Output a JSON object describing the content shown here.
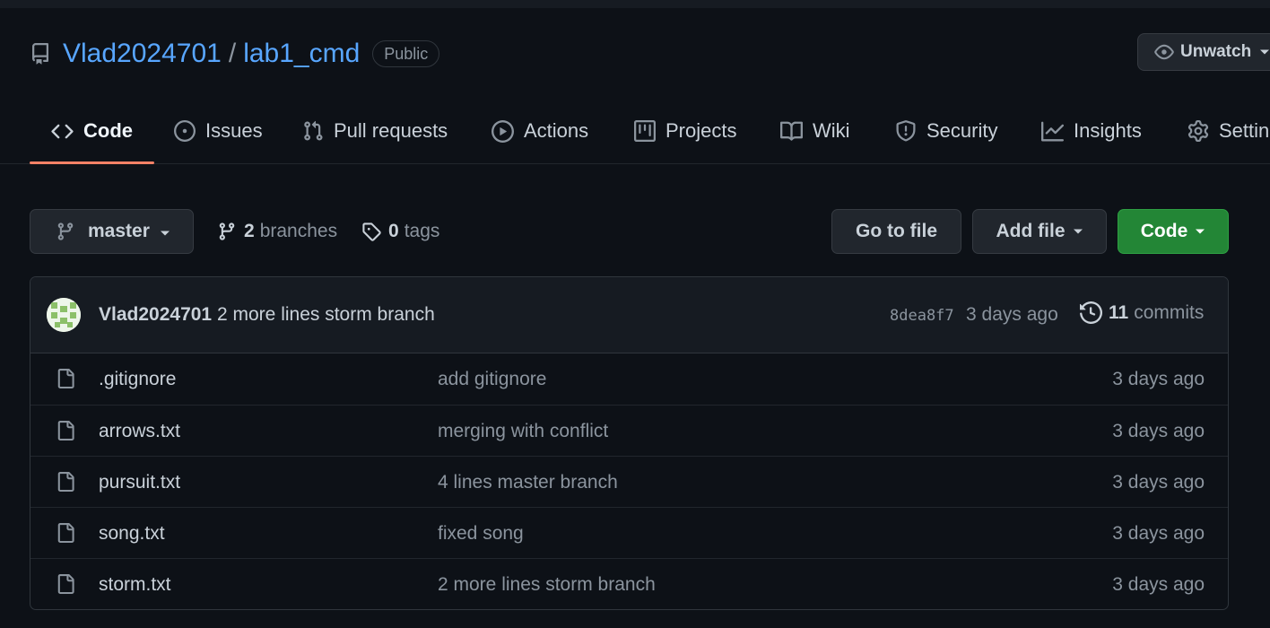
{
  "repo": {
    "owner": "Vlad2024701",
    "separator": "/",
    "name": "lab1_cmd",
    "visibility": "Public",
    "watch_label": "Unwatch"
  },
  "tabs": [
    {
      "label": "Code",
      "icon": "code-icon",
      "active": true
    },
    {
      "label": "Issues",
      "icon": "issue-icon"
    },
    {
      "label": "Pull requests",
      "icon": "pull-request-icon"
    },
    {
      "label": "Actions",
      "icon": "play-icon"
    },
    {
      "label": "Projects",
      "icon": "project-icon"
    },
    {
      "label": "Wiki",
      "icon": "book-icon"
    },
    {
      "label": "Security",
      "icon": "shield-icon"
    },
    {
      "label": "Insights",
      "icon": "graph-icon"
    },
    {
      "label": "Settin",
      "icon": "gear-icon"
    }
  ],
  "toolbar": {
    "branch": "master",
    "branches_count": "2",
    "branches_label": "branches",
    "tags_count": "0",
    "tags_label": "tags",
    "go_to_file": "Go to file",
    "add_file": "Add file",
    "code": "Code"
  },
  "latest_commit": {
    "author": "Vlad2024701",
    "message": "2 more lines storm branch",
    "sha": "8dea8f7",
    "age": "3 days ago",
    "commits_count": "11",
    "commits_label": "commits"
  },
  "files": [
    {
      "name": ".gitignore",
      "message": "add gitignore",
      "age": "3 days ago"
    },
    {
      "name": "arrows.txt",
      "message": "merging with conflict",
      "age": "3 days ago"
    },
    {
      "name": "pursuit.txt",
      "message": "4 lines master branch",
      "age": "3 days ago"
    },
    {
      "name": "song.txt",
      "message": "fixed song",
      "age": "3 days ago"
    },
    {
      "name": "storm.txt",
      "message": "2 more lines storm branch",
      "age": "3 days ago"
    }
  ],
  "colors": {
    "background": "#0d1117",
    "link": "#58a6ff",
    "active_tab_underline": "#f78166",
    "primary_button": "#238636"
  }
}
